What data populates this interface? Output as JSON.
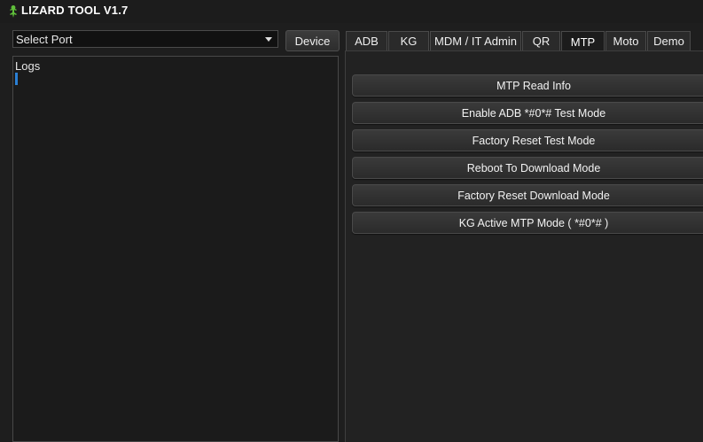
{
  "app": {
    "title": "LIZARD TOOL V1.7",
    "icon": "lizard-icon",
    "icon_color": "#5fbf3a"
  },
  "port": {
    "selected": "Select Port"
  },
  "device_button": "Device",
  "logs": {
    "title": "Logs",
    "cursor_color": "#2a7fd4"
  },
  "tabs": [
    {
      "label": "ADB"
    },
    {
      "label": "KG"
    },
    {
      "label": "MDM / IT Admin"
    },
    {
      "label": "QR"
    },
    {
      "label": "MTP",
      "active": true
    },
    {
      "label": "Moto"
    },
    {
      "label": "Demo"
    }
  ],
  "mtp": {
    "buttons": [
      {
        "label": "MTP Read Info"
      },
      {
        "label": "Enable ADB *#0*# Test Mode"
      },
      {
        "label": "Factory Reset Test Mode"
      },
      {
        "label": "Reboot To Download Mode"
      },
      {
        "label": "Factory Reset Download Mode"
      },
      {
        "label": "KG Active MTP Mode ( *#0*# )"
      }
    ]
  }
}
